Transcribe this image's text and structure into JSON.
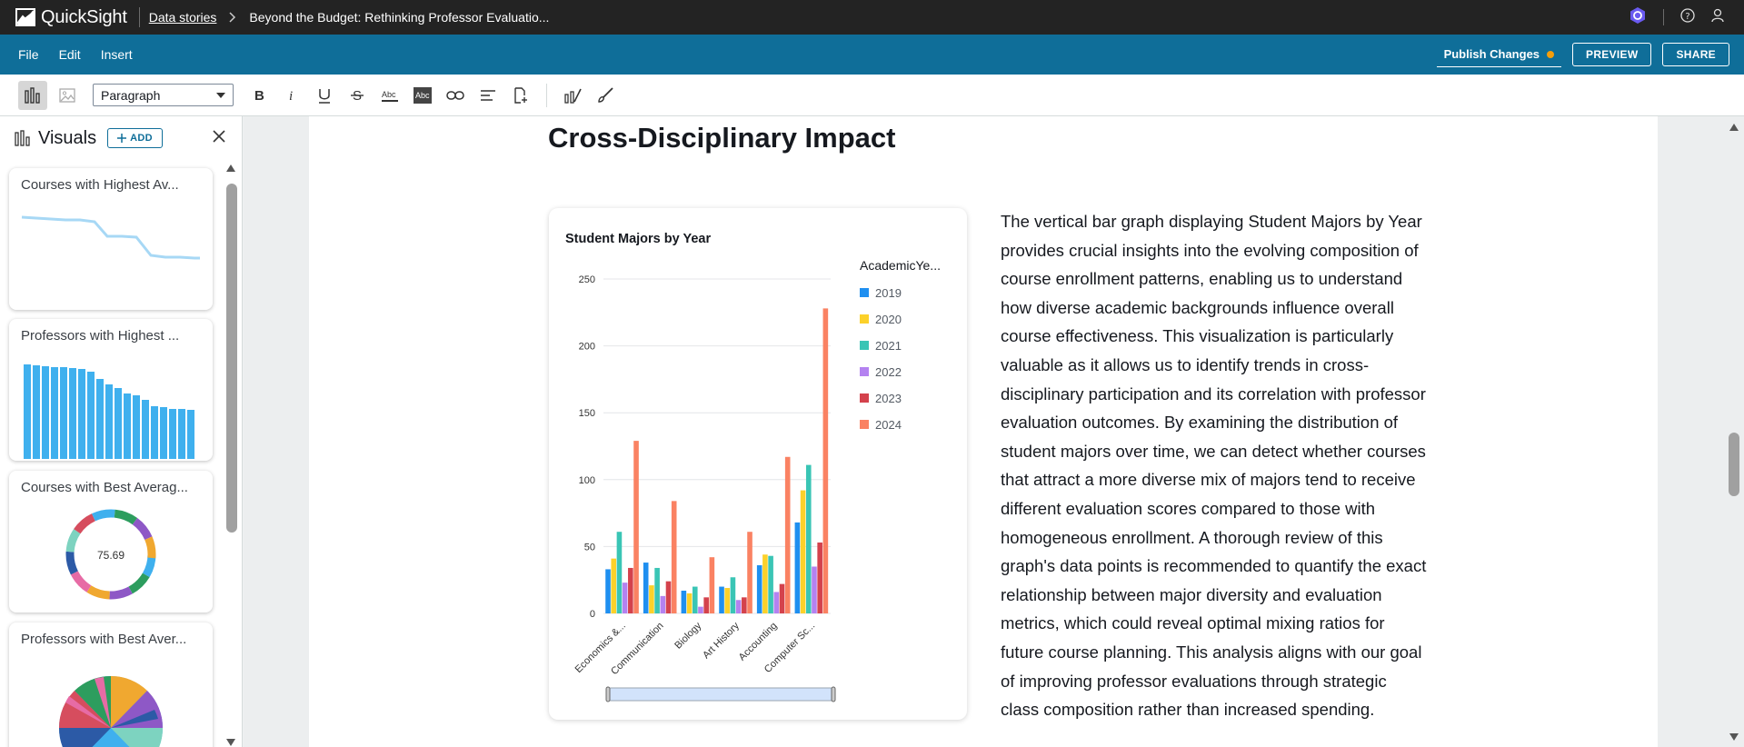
{
  "topbar": {
    "app_name": "QuickSight",
    "breadcrumb_link": "Data stories",
    "breadcrumb_current": "Beyond the Budget: Rethinking Professor Evaluatio..."
  },
  "menubar": {
    "menus": [
      "File",
      "Edit",
      "Insert"
    ],
    "publish_label": "Publish Changes",
    "preview_label": "PREVIEW",
    "share_label": "SHARE"
  },
  "toolbar": {
    "paragraph_style": "Paragraph"
  },
  "sidebar": {
    "title": "Visuals",
    "add_label": "ADD",
    "cards": [
      {
        "title": "Courses with Highest Av..."
      },
      {
        "title": "Professors with Highest ..."
      },
      {
        "title": "Courses with Best Averag...",
        "donut_value": "75.69"
      },
      {
        "title": "Professors with Best Aver..."
      }
    ]
  },
  "story": {
    "heading": "Cross-Disciplinary Impact",
    "paragraph": "The vertical bar graph displaying Student Majors by Year provides crucial insights into the evolving composition of course enrollment patterns, enabling us to understand how diverse academic backgrounds influence overall course effectiveness. This visualization is particularly valuable as it allows us to identify trends in cross-disciplinary participation and its correlation with professor evaluation outcomes. By examining the distribution of student majors over time, we can detect whether courses that attract a more diverse mix of majors tend to receive different evaluation scores compared to those with homogeneous enrollment. A thorough review of this graph's data points is recommended to quantify the exact relationship between major diversity and evaluation metrics, which could reveal optimal mixing ratios for future course planning. This analysis aligns with our goal of improving professor evaluations through strategic class composition rather than increased spending."
  },
  "chart_data": {
    "type": "bar",
    "title": "Student Majors by Year",
    "legend_title": "AcademicYe...",
    "legend_position": "right",
    "categories": [
      "Economics &...",
      "Communication",
      "Biology",
      "Art History",
      "Accounting",
      "Computer Sc..."
    ],
    "ylim": [
      0,
      250
    ],
    "yticks": [
      0,
      50,
      100,
      150,
      200,
      250
    ],
    "grid": true,
    "series": [
      {
        "name": "2019",
        "color": "#1f8ff0",
        "values": [
          33,
          38,
          17,
          20,
          36,
          68
        ]
      },
      {
        "name": "2020",
        "color": "#fcd12a",
        "values": [
          41,
          21,
          15,
          19,
          44,
          92
        ]
      },
      {
        "name": "2021",
        "color": "#3ac5b5",
        "values": [
          61,
          34,
          20,
          27,
          43,
          111
        ]
      },
      {
        "name": "2022",
        "color": "#b482f0",
        "values": [
          23,
          13,
          5,
          10,
          16,
          35
        ]
      },
      {
        "name": "2023",
        "color": "#d4424c",
        "values": [
          34,
          24,
          12,
          12,
          22,
          53
        ]
      },
      {
        "name": "2024",
        "color": "#fa8263",
        "values": [
          129,
          84,
          42,
          61,
          117,
          228
        ]
      }
    ]
  }
}
